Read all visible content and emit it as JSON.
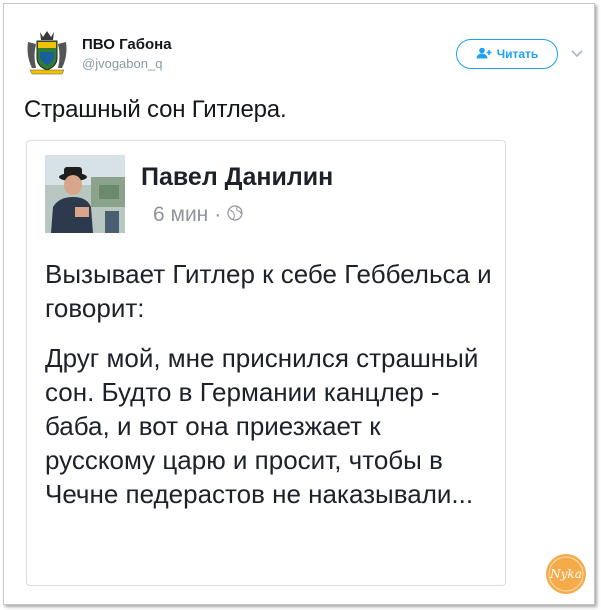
{
  "tweet": {
    "author_name": "ПВО Габона",
    "author_handle": "@jvogabon_q",
    "follow_label": "Читать",
    "text": "Страшный сон Гитлера."
  },
  "embed": {
    "author_name": "Павел Данилин",
    "time": "6 мин",
    "separator": "·",
    "paragraphs": [
      "Вызывает Гитлер к себе Геббельса и говорит:",
      "Друг мой, мне приснился страшный сон. Будто в Германии канцлер - баба, и вот она приезжает к русскому царю и просит, чтобы в Чечне педерастов не наказывали..."
    ]
  },
  "watermark": {
    "text": "Nyka"
  },
  "colors": {
    "accent": "#1da1f2",
    "text": "#14171a",
    "muted": "#8899a6",
    "fb_text": "#1d2129",
    "fb_muted": "#90949c",
    "watermark_orange": "#f39c2a"
  },
  "icons": {
    "avatar": "coat-of-arms-icon",
    "follow": "add-user-icon",
    "caret": "chevron-down-icon",
    "privacy": "globe-icon"
  }
}
